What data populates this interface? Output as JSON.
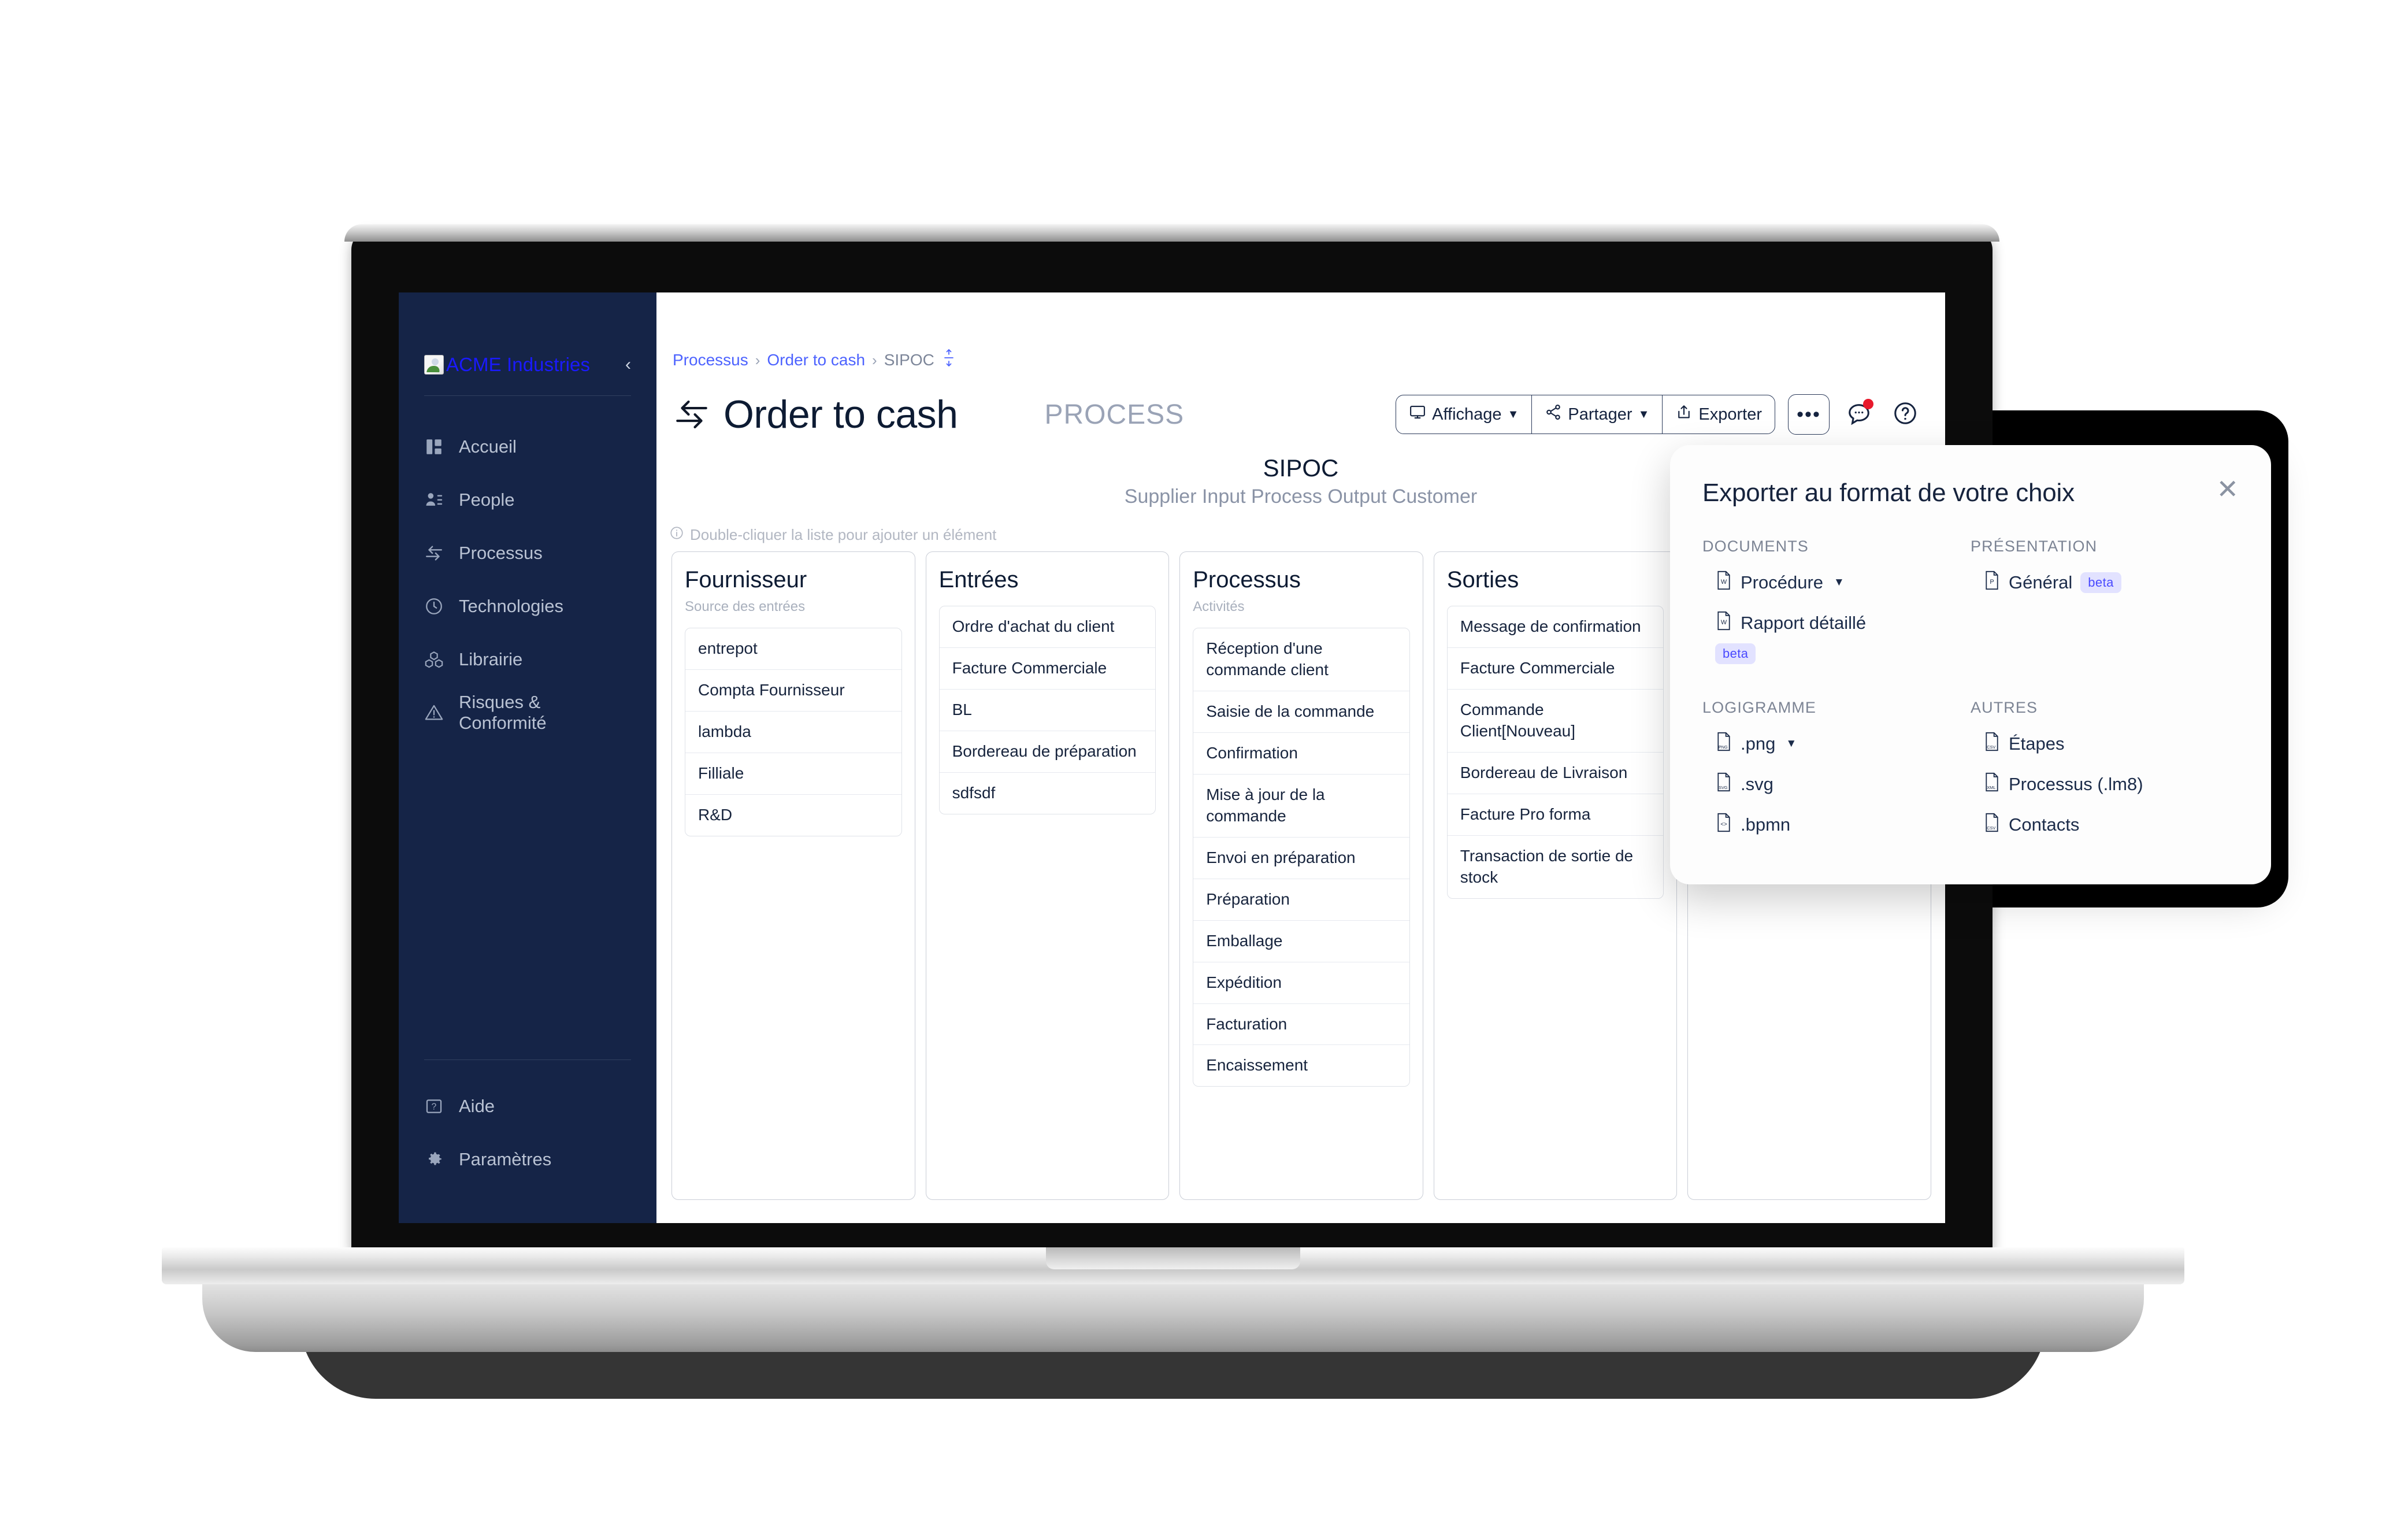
{
  "sidebar": {
    "brand": "ACME Industries",
    "collapse_icon": "chevron-left-icon",
    "items": [
      {
        "label": "Accueil",
        "icon": "dashboard-icon"
      },
      {
        "label": "People",
        "icon": "people-icon"
      },
      {
        "label": "Processus",
        "icon": "process-arrows-icon"
      },
      {
        "label": "Technologies",
        "icon": "plug-icon"
      },
      {
        "label": "Librairie",
        "icon": "blocks-icon"
      },
      {
        "label": "Risques & Conformité",
        "icon": "warning-triangle-icon"
      }
    ],
    "bottom_items": [
      {
        "label": "Aide",
        "icon": "question-box-icon"
      },
      {
        "label": "Paramètres",
        "icon": "gear-icon"
      }
    ]
  },
  "breadcrumb": {
    "items": [
      "Processus",
      "Order to cash",
      "SIPOC"
    ],
    "separator": "›",
    "expand_icon": "vertical-resize-icon"
  },
  "header": {
    "title": "Order to cash",
    "title_icon": "process-arrows-icon",
    "type_label": "PROCESS",
    "buttons": [
      {
        "label": "Affichage",
        "icon": "monitor-icon",
        "caret": true
      },
      {
        "label": "Partager",
        "icon": "share-icon",
        "caret": true
      },
      {
        "label": "Exporter",
        "icon": "export-icon",
        "caret": false
      }
    ],
    "more_button": "•••",
    "comment_icon": "comment-icon",
    "help_icon": "help-circle-icon",
    "notification_badge": true
  },
  "board": {
    "title": "SIPOC",
    "subtitle": "Supplier Input Process Output Customer",
    "hint": "Double-cliquer la liste pour ajouter un élément",
    "hint_icon": "info-icon",
    "columns": [
      {
        "title": "Fournisseur",
        "subtitle": "Source des entrées",
        "items": [
          "entrepot",
          "Compta Fournisseur",
          "lambda",
          "Filliale",
          "R&D"
        ]
      },
      {
        "title": "Entrées",
        "subtitle": "",
        "items": [
          "Ordre d'achat du client",
          "Facture Commerciale",
          "BL",
          "Bordereau de préparation",
          "sdfsdf"
        ]
      },
      {
        "title": "Processus",
        "subtitle": "Activités",
        "items": [
          "Réception d'une commande client",
          "Saisie de la commande",
          "Confirmation",
          "Mise à jour de la commande",
          "Envoi en préparation",
          "Préparation",
          "Emballage",
          "Expédition",
          "Facturation",
          "Encaissement"
        ]
      },
      {
        "title": "Sorties",
        "subtitle": "",
        "items": [
          "Message de confirmation",
          "Facture Commerciale",
          "Commande Client[Nouveau]",
          "Bordereau de Livraison",
          "Facture Pro forma",
          "Transaction de sortie de stock"
        ]
      },
      {
        "title": "",
        "subtitle": "",
        "items": []
      }
    ]
  },
  "export_modal": {
    "title": "Exporter au format de votre choix",
    "close_icon": "close-icon",
    "sections": [
      {
        "heading": "DOCUMENTS",
        "items": [
          {
            "label": "Procédure",
            "icon": "word-file-icon",
            "caret": true,
            "badge": ""
          },
          {
            "label": "Rapport détaillé",
            "icon": "word-file-icon",
            "caret": false,
            "badge": "beta",
            "badge_below": true
          }
        ]
      },
      {
        "heading": "PRÉSENTATION",
        "items": [
          {
            "label": "Général",
            "icon": "powerpoint-file-icon",
            "caret": false,
            "badge": "beta"
          }
        ]
      },
      {
        "heading": "LOGIGRAMME",
        "items": [
          {
            "label": ".png",
            "icon": "png-file-icon",
            "caret": true,
            "badge": ""
          },
          {
            "label": ".svg",
            "icon": "svg-file-icon",
            "caret": false,
            "badge": ""
          },
          {
            "label": ".bpmn",
            "icon": "code-file-icon",
            "caret": false,
            "badge": ""
          }
        ]
      },
      {
        "heading": "AUTRES",
        "items": [
          {
            "label": "Étapes",
            "icon": "csv-file-icon",
            "caret": false,
            "badge": ""
          },
          {
            "label": "Processus (.lm8)",
            "icon": "xml-file-icon",
            "caret": false,
            "badge": ""
          },
          {
            "label": "Contacts",
            "icon": "csv-file-icon",
            "caret": false,
            "badge": ""
          }
        ]
      }
    ]
  },
  "colors": {
    "sidebar_bg": "#152447",
    "link": "#4d63ff",
    "brand_text": "#1a1aff",
    "beta_bg": "#e2e2ff",
    "beta_text": "#4a4aff",
    "notification": "#e8192c",
    "title": "#0d1b33"
  }
}
